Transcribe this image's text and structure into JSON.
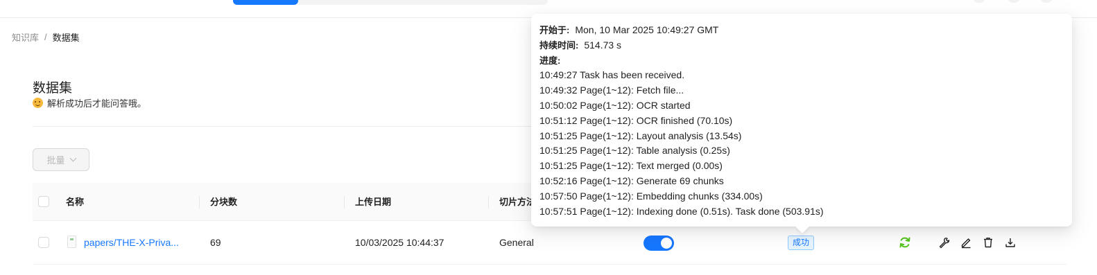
{
  "breadcrumb": {
    "parent": "知识库",
    "separator": "/",
    "current": "数据集"
  },
  "section": {
    "title": "数据集",
    "hint": "解析成功后才能问答哦。"
  },
  "bulk_button": {
    "label": "批量"
  },
  "table": {
    "columns": [
      "名称",
      "分块数",
      "上传日期",
      "切片方法"
    ],
    "rows": [
      {
        "name": "papers/THE-X-Priva...",
        "chunks": "69",
        "upload_date": "10/03/2025 10:44:37",
        "parser": "General",
        "enabled": true,
        "status": "成功"
      }
    ]
  },
  "tooltip": {
    "start_label": "开始于:",
    "start_value": "Mon, 10 Mar 2025 10:49:27 GMT",
    "duration_label": "持续时间:",
    "duration_value": "514.73 s",
    "progress_label": "进度:",
    "progress_lines": [
      "10:49:27 Task has been received.",
      "10:49:32 Page(1~12): Fetch file...",
      "10:50:02 Page(1~12): OCR started",
      "10:51:12 Page(1~12): OCR finished (70.10s)",
      "10:51:25 Page(1~12): Layout analysis (13.54s)",
      "10:51:25 Page(1~12): Table analysis (0.25s)",
      "10:51:25 Page(1~12): Text merged (0.00s)",
      "10:52:16 Page(1~12): Generate 69 chunks",
      "10:57:50 Page(1~12): Embedding chunks (334.00s)",
      "10:57:51 Page(1~12): Indexing done (0.51s). Task done (503.91s)"
    ]
  },
  "icons": {
    "emoji": "smiling-face-icon",
    "file": "file-icon",
    "rerun": "sync-icon",
    "settings": "wrench-icon",
    "rename": "edit-icon",
    "delete": "trash-icon",
    "download": "download-icon"
  },
  "colors": {
    "accent": "#1677ff",
    "success": "#52c41a"
  }
}
